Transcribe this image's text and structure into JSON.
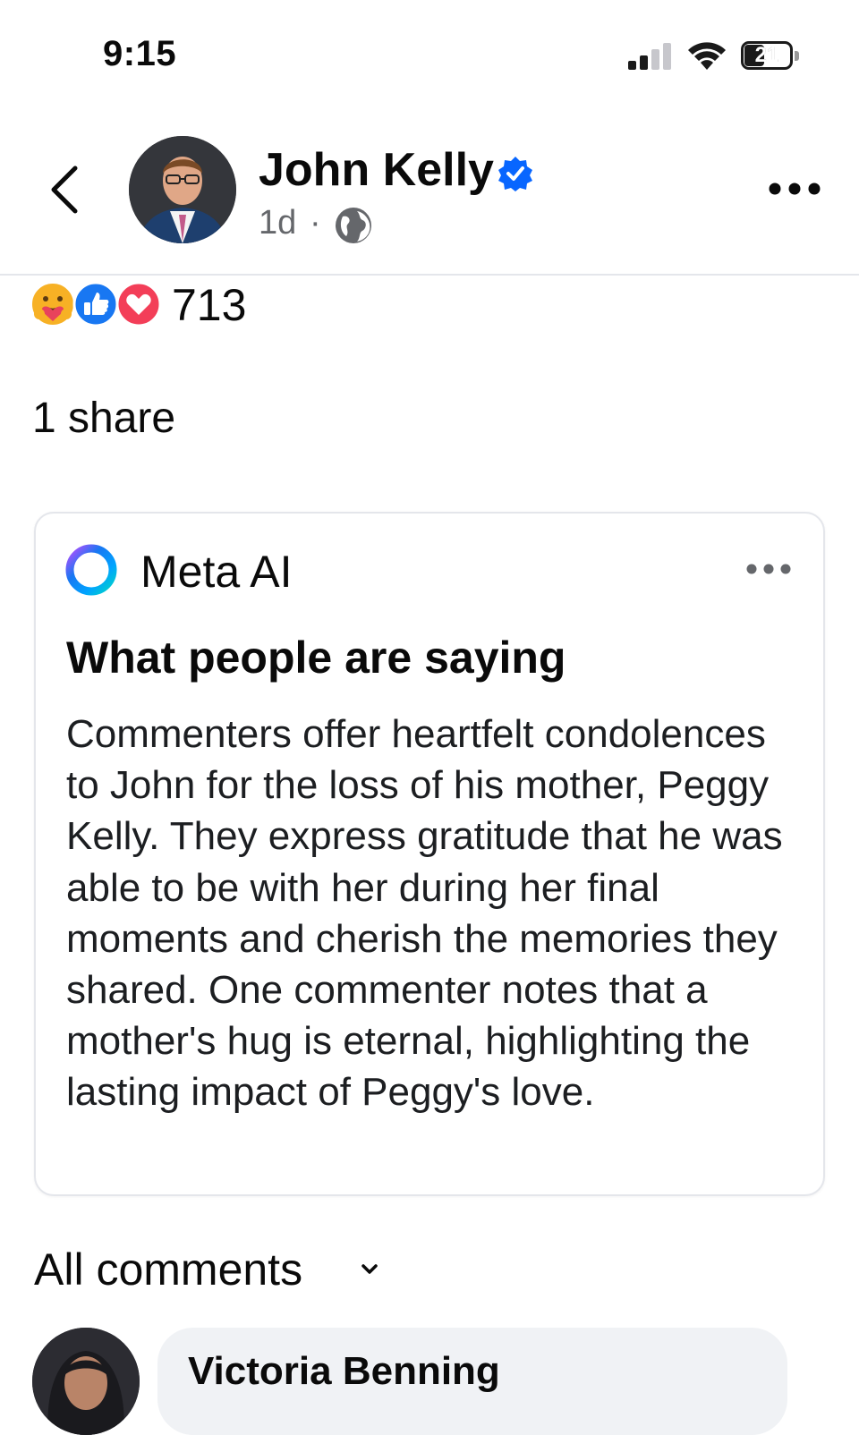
{
  "status_bar": {
    "time": "9:15",
    "battery_level": "21",
    "icons": [
      "cellular-signal-icon",
      "wifi-icon",
      "battery-icon"
    ]
  },
  "post_header": {
    "author_name": "John Kelly",
    "verified": true,
    "timestamp": "1d",
    "separator": "·",
    "audience_icon": "globe-icon",
    "icons": [
      "back-chevron-icon",
      "verified-badge-icon",
      "more-horizontal-icon"
    ]
  },
  "engagement": {
    "reaction_count": "713",
    "reaction_icons": [
      "care-reaction-icon",
      "like-reaction-icon",
      "love-reaction-icon"
    ],
    "share_text": "1 share"
  },
  "ai_summary": {
    "provider": "Meta AI",
    "title": "What people are saying",
    "summary": "Commenters offer heartfelt condolences to John for the loss of his mother, Peggy Kelly. They express gratitude that he was able to be with her during her final moments and cherish the memories they shared. One commenter notes that a mother's hug is eternal, highlighting the lasting impact of Peggy's love.",
    "icons": [
      "meta-ai-ring-icon",
      "more-horizontal-icon"
    ]
  },
  "comments": {
    "filter_label": "All comments",
    "first_commenter": "Victoria Benning"
  },
  "colors": {
    "verified_blue": "#0866ff",
    "secondary_text": "#65676b",
    "bubble_bg": "#f0f2f5",
    "divider": "#e4e6eb"
  }
}
